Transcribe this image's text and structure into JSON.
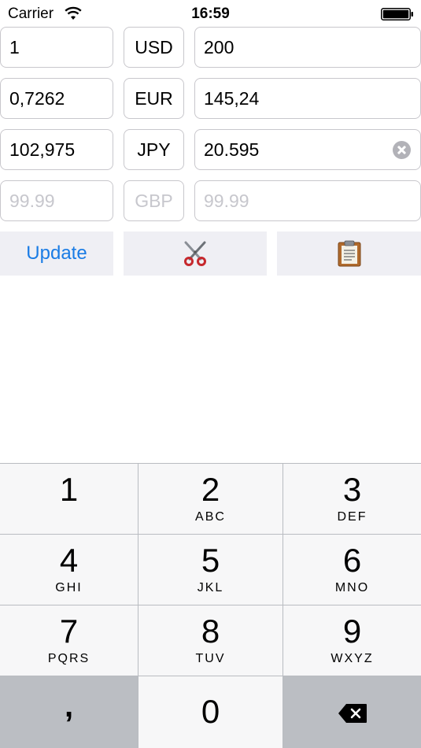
{
  "status_bar": {
    "carrier": "Carrier",
    "time": "16:59"
  },
  "rows": [
    {
      "amount": "1",
      "code": "USD",
      "converted": "200"
    },
    {
      "amount": "0,7262",
      "code": "EUR",
      "converted": "145,24"
    },
    {
      "amount": "102,975",
      "code": "JPY",
      "converted": "20.595"
    },
    {
      "amount_placeholder": "99.99",
      "code_placeholder": "GBP",
      "converted_placeholder": "99.99"
    }
  ],
  "actions": {
    "update_label": "Update",
    "cut_icon": "scissors-icon",
    "paste_icon": "clipboard-icon"
  },
  "keypad": {
    "keys": [
      {
        "digit": "1",
        "letters": ""
      },
      {
        "digit": "2",
        "letters": "ABC"
      },
      {
        "digit": "3",
        "letters": "DEF"
      },
      {
        "digit": "4",
        "letters": "GHI"
      },
      {
        "digit": "5",
        "letters": "JKL"
      },
      {
        "digit": "6",
        "letters": "MNO"
      },
      {
        "digit": "7",
        "letters": "PQRS"
      },
      {
        "digit": "8",
        "letters": "TUV"
      },
      {
        "digit": "9",
        "letters": "WXYZ"
      }
    ],
    "comma": ",",
    "zero": "0",
    "delete_icon": "backspace-icon"
  },
  "colors": {
    "accent": "#1a7ce5",
    "field_border": "#c8c7cc",
    "placeholder": "#c7c7cd",
    "action_bg": "#efeff4",
    "key_bg": "#f7f7f8",
    "key_dark_bg": "#bbbec3"
  }
}
